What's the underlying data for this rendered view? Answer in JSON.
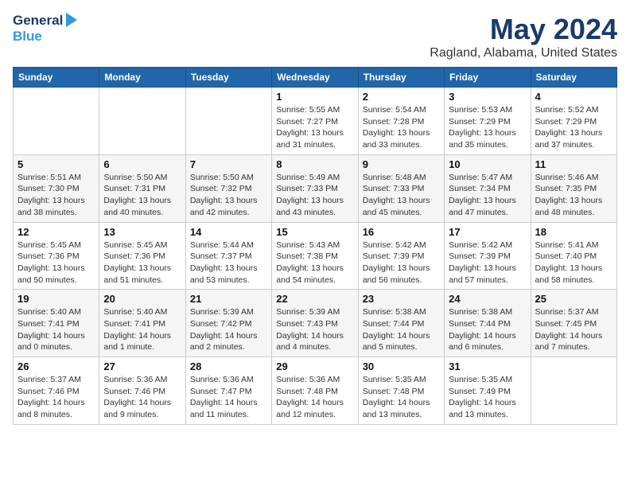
{
  "header": {
    "logo_line1": "General",
    "logo_line2": "Blue",
    "title": "May 2024",
    "subtitle": "Ragland, Alabama, United States"
  },
  "calendar": {
    "days_of_week": [
      "Sunday",
      "Monday",
      "Tuesday",
      "Wednesday",
      "Thursday",
      "Friday",
      "Saturday"
    ],
    "weeks": [
      [
        {
          "day": "",
          "info": ""
        },
        {
          "day": "",
          "info": ""
        },
        {
          "day": "",
          "info": ""
        },
        {
          "day": "1",
          "info": "Sunrise: 5:55 AM\nSunset: 7:27 PM\nDaylight: 13 hours\nand 31 minutes."
        },
        {
          "day": "2",
          "info": "Sunrise: 5:54 AM\nSunset: 7:28 PM\nDaylight: 13 hours\nand 33 minutes."
        },
        {
          "day": "3",
          "info": "Sunrise: 5:53 AM\nSunset: 7:29 PM\nDaylight: 13 hours\nand 35 minutes."
        },
        {
          "day": "4",
          "info": "Sunrise: 5:52 AM\nSunset: 7:29 PM\nDaylight: 13 hours\nand 37 minutes."
        }
      ],
      [
        {
          "day": "5",
          "info": "Sunrise: 5:51 AM\nSunset: 7:30 PM\nDaylight: 13 hours\nand 38 minutes."
        },
        {
          "day": "6",
          "info": "Sunrise: 5:50 AM\nSunset: 7:31 PM\nDaylight: 13 hours\nand 40 minutes."
        },
        {
          "day": "7",
          "info": "Sunrise: 5:50 AM\nSunset: 7:32 PM\nDaylight: 13 hours\nand 42 minutes."
        },
        {
          "day": "8",
          "info": "Sunrise: 5:49 AM\nSunset: 7:33 PM\nDaylight: 13 hours\nand 43 minutes."
        },
        {
          "day": "9",
          "info": "Sunrise: 5:48 AM\nSunset: 7:33 PM\nDaylight: 13 hours\nand 45 minutes."
        },
        {
          "day": "10",
          "info": "Sunrise: 5:47 AM\nSunset: 7:34 PM\nDaylight: 13 hours\nand 47 minutes."
        },
        {
          "day": "11",
          "info": "Sunrise: 5:46 AM\nSunset: 7:35 PM\nDaylight: 13 hours\nand 48 minutes."
        }
      ],
      [
        {
          "day": "12",
          "info": "Sunrise: 5:45 AM\nSunset: 7:36 PM\nDaylight: 13 hours\nand 50 minutes."
        },
        {
          "day": "13",
          "info": "Sunrise: 5:45 AM\nSunset: 7:36 PM\nDaylight: 13 hours\nand 51 minutes."
        },
        {
          "day": "14",
          "info": "Sunrise: 5:44 AM\nSunset: 7:37 PM\nDaylight: 13 hours\nand 53 minutes."
        },
        {
          "day": "15",
          "info": "Sunrise: 5:43 AM\nSunset: 7:38 PM\nDaylight: 13 hours\nand 54 minutes."
        },
        {
          "day": "16",
          "info": "Sunrise: 5:42 AM\nSunset: 7:39 PM\nDaylight: 13 hours\nand 56 minutes."
        },
        {
          "day": "17",
          "info": "Sunrise: 5:42 AM\nSunset: 7:39 PM\nDaylight: 13 hours\nand 57 minutes."
        },
        {
          "day": "18",
          "info": "Sunrise: 5:41 AM\nSunset: 7:40 PM\nDaylight: 13 hours\nand 58 minutes."
        }
      ],
      [
        {
          "day": "19",
          "info": "Sunrise: 5:40 AM\nSunset: 7:41 PM\nDaylight: 14 hours\nand 0 minutes."
        },
        {
          "day": "20",
          "info": "Sunrise: 5:40 AM\nSunset: 7:41 PM\nDaylight: 14 hours\nand 1 minute."
        },
        {
          "day": "21",
          "info": "Sunrise: 5:39 AM\nSunset: 7:42 PM\nDaylight: 14 hours\nand 2 minutes."
        },
        {
          "day": "22",
          "info": "Sunrise: 5:39 AM\nSunset: 7:43 PM\nDaylight: 14 hours\nand 4 minutes."
        },
        {
          "day": "23",
          "info": "Sunrise: 5:38 AM\nSunset: 7:44 PM\nDaylight: 14 hours\nand 5 minutes."
        },
        {
          "day": "24",
          "info": "Sunrise: 5:38 AM\nSunset: 7:44 PM\nDaylight: 14 hours\nand 6 minutes."
        },
        {
          "day": "25",
          "info": "Sunrise: 5:37 AM\nSunset: 7:45 PM\nDaylight: 14 hours\nand 7 minutes."
        }
      ],
      [
        {
          "day": "26",
          "info": "Sunrise: 5:37 AM\nSunset: 7:46 PM\nDaylight: 14 hours\nand 8 minutes."
        },
        {
          "day": "27",
          "info": "Sunrise: 5:36 AM\nSunset: 7:46 PM\nDaylight: 14 hours\nand 9 minutes."
        },
        {
          "day": "28",
          "info": "Sunrise: 5:36 AM\nSunset: 7:47 PM\nDaylight: 14 hours\nand 11 minutes."
        },
        {
          "day": "29",
          "info": "Sunrise: 5:36 AM\nSunset: 7:48 PM\nDaylight: 14 hours\nand 12 minutes."
        },
        {
          "day": "30",
          "info": "Sunrise: 5:35 AM\nSunset: 7:48 PM\nDaylight: 14 hours\nand 13 minutes."
        },
        {
          "day": "31",
          "info": "Sunrise: 5:35 AM\nSunset: 7:49 PM\nDaylight: 14 hours\nand 13 minutes."
        },
        {
          "day": "",
          "info": ""
        }
      ]
    ]
  }
}
